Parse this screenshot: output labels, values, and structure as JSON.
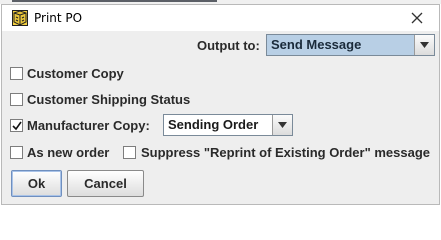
{
  "window": {
    "title": "Print PO",
    "app_icon": "cube-icon",
    "close_icon": "close-icon"
  },
  "output": {
    "label": "Output to:",
    "selected": "Send Message"
  },
  "checkboxes": {
    "customer_copy": {
      "label": "Customer Copy",
      "checked": false
    },
    "customer_shipping_status": {
      "label": "Customer Shipping Status",
      "checked": false
    },
    "manufacturer_copy": {
      "label": "Manufacturer Copy:",
      "checked": true
    },
    "as_new_order": {
      "label": "As new order",
      "checked": false
    },
    "suppress_reprint": {
      "label": "Suppress \"Reprint of Existing Order\" message",
      "checked": false
    }
  },
  "manufacturer_copy_combo": {
    "selected": "Sending Order"
  },
  "buttons": {
    "ok": "Ok",
    "cancel": "Cancel"
  },
  "colors": {
    "dialog_bg": "#eeeeee",
    "combo_selection": "#b8cfe5",
    "focus_border": "#6f8fbf"
  }
}
